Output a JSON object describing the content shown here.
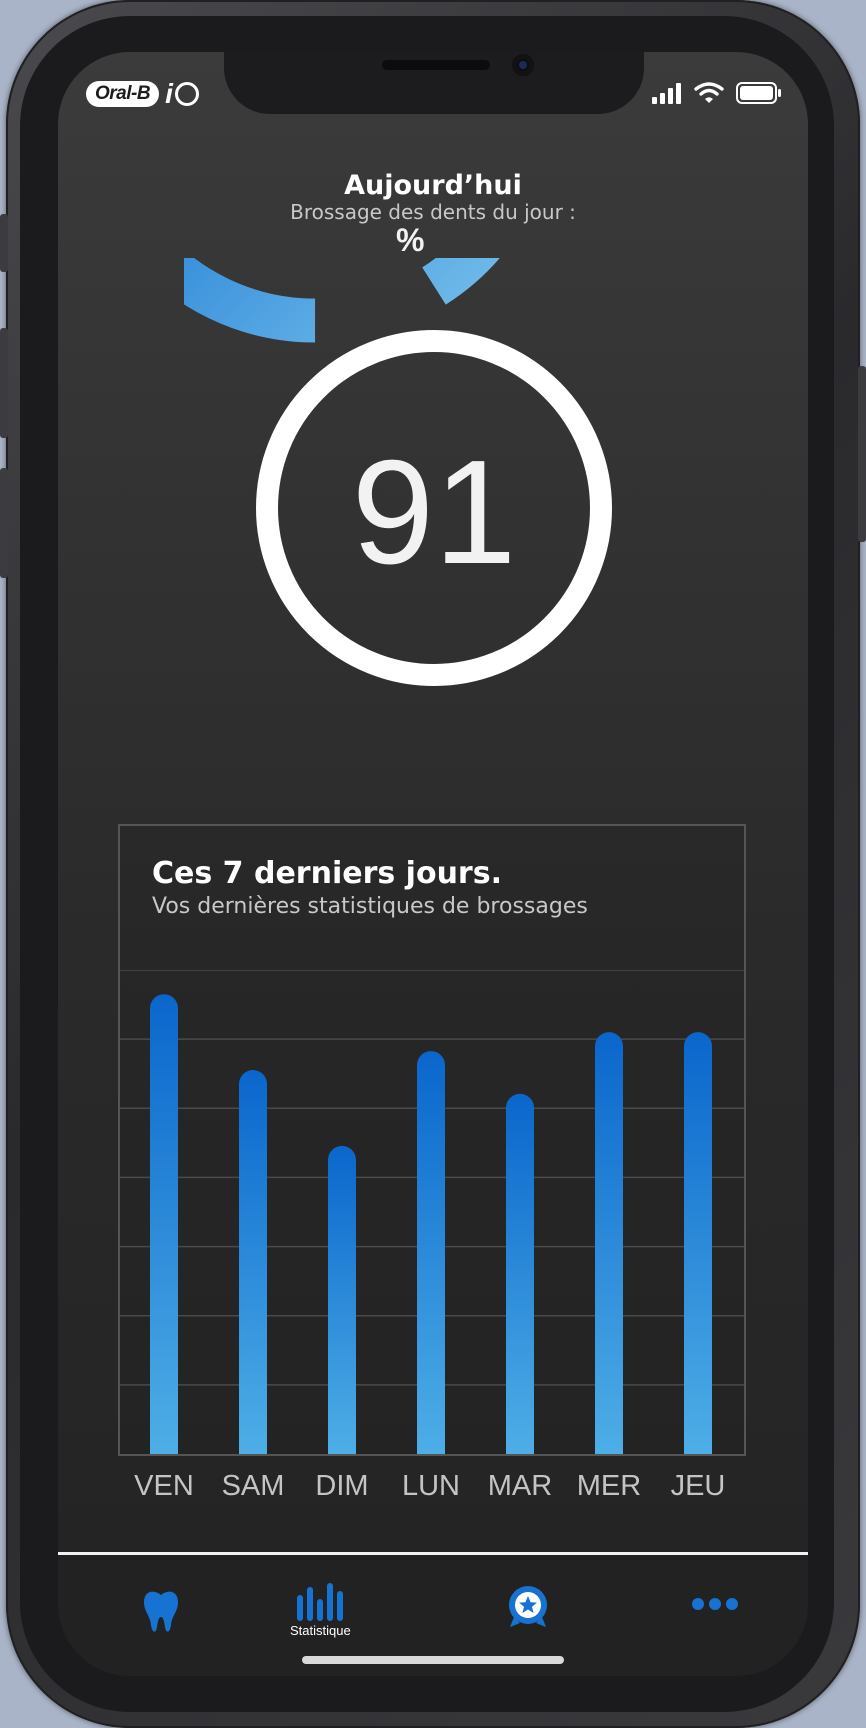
{
  "app": {
    "brand": "Oral-B",
    "brand_suffix": "i"
  },
  "status_bar": {
    "icons": [
      "cellular-signal-icon",
      "wifi-icon",
      "battery-icon"
    ]
  },
  "today": {
    "title": "Aujourd’hui",
    "subtitle": "Brossage des dents du jour :",
    "score": "91",
    "unit": "%",
    "progress_percent": 91
  },
  "last7": {
    "title": "Ces 7 derniers jours.",
    "subtitle": "Vos dernières statistiques de brossages"
  },
  "chart_data": {
    "type": "bar",
    "categories": [
      "VEN",
      "SAM",
      "DIM",
      "LUN",
      "MAR",
      "MER",
      "JEU"
    ],
    "values": [
      97,
      81,
      65,
      85,
      76,
      89,
      89
    ],
    "ylim": [
      0,
      100
    ],
    "grid": true
  },
  "nav": {
    "items": [
      {
        "icon": "tooth-icon",
        "label": ""
      },
      {
        "icon": "bar-chart-icon",
        "label": "Statistique"
      },
      {
        "icon": "award-badge-icon",
        "label": ""
      },
      {
        "icon": "more-dots-icon",
        "label": ""
      }
    ]
  },
  "colors": {
    "accent_dark": "#0060c8",
    "accent_light": "#5ab4e6",
    "background": "#2c2c2c"
  }
}
